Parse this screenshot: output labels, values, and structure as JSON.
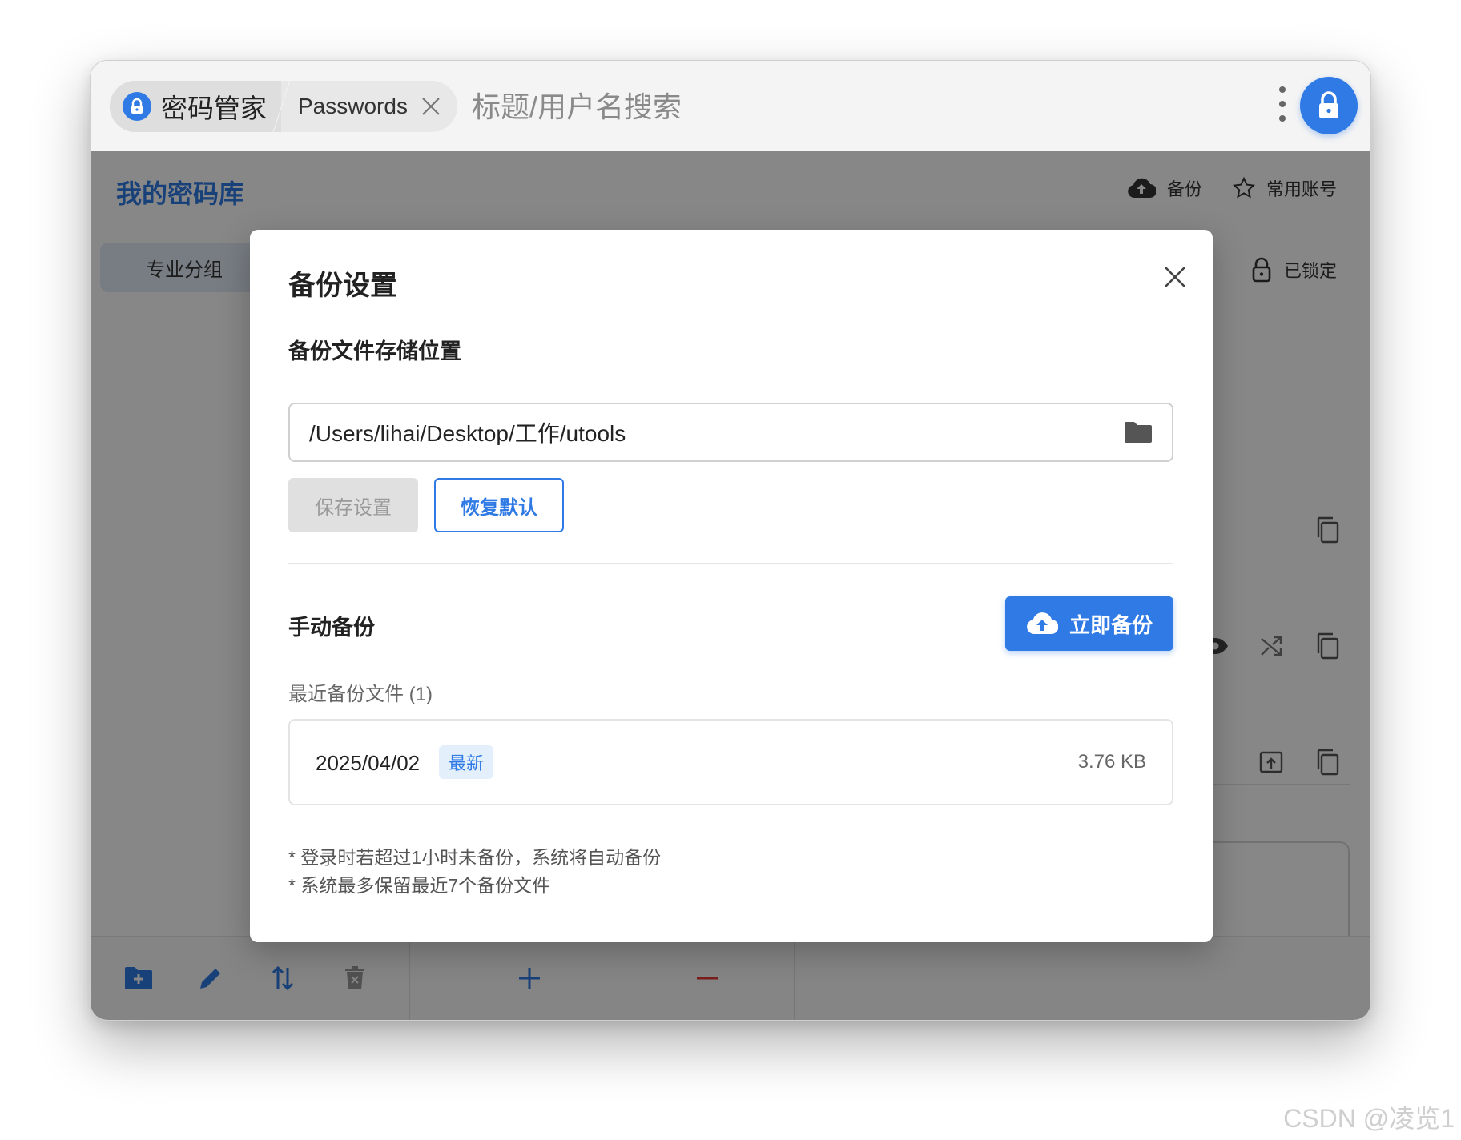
{
  "topbar": {
    "app_name": "密码管家",
    "sub_tab": "Passwords",
    "search_placeholder": "标题/用户名搜索"
  },
  "app": {
    "vault_title": "我的密码库",
    "backup_action": "备份",
    "favorites_action": "常用账号",
    "group_tab": "专业分组",
    "lock_status": "已锁定"
  },
  "dialog": {
    "title": "备份设置",
    "storage_label": "备份文件存储位置",
    "path_value": "/Users/lihai/Desktop/工作/utools",
    "save_button": "保存设置",
    "restore_button": "恢复默认",
    "manual_label": "手动备份",
    "backup_now_button": "立即备份",
    "recent_label": "最近备份文件 (1)",
    "files": [
      {
        "date": "2025/04/02",
        "badge": "最新",
        "size": "3.76 KB"
      }
    ],
    "notes": [
      "* 登录时若超过1小时未备份，系统将自动备份",
      "* 系统最多保留最近7个备份文件"
    ]
  },
  "watermark": "CSDN @凌览1",
  "colors": {
    "accent": "#2f7ae5",
    "delete": "#e53935"
  }
}
